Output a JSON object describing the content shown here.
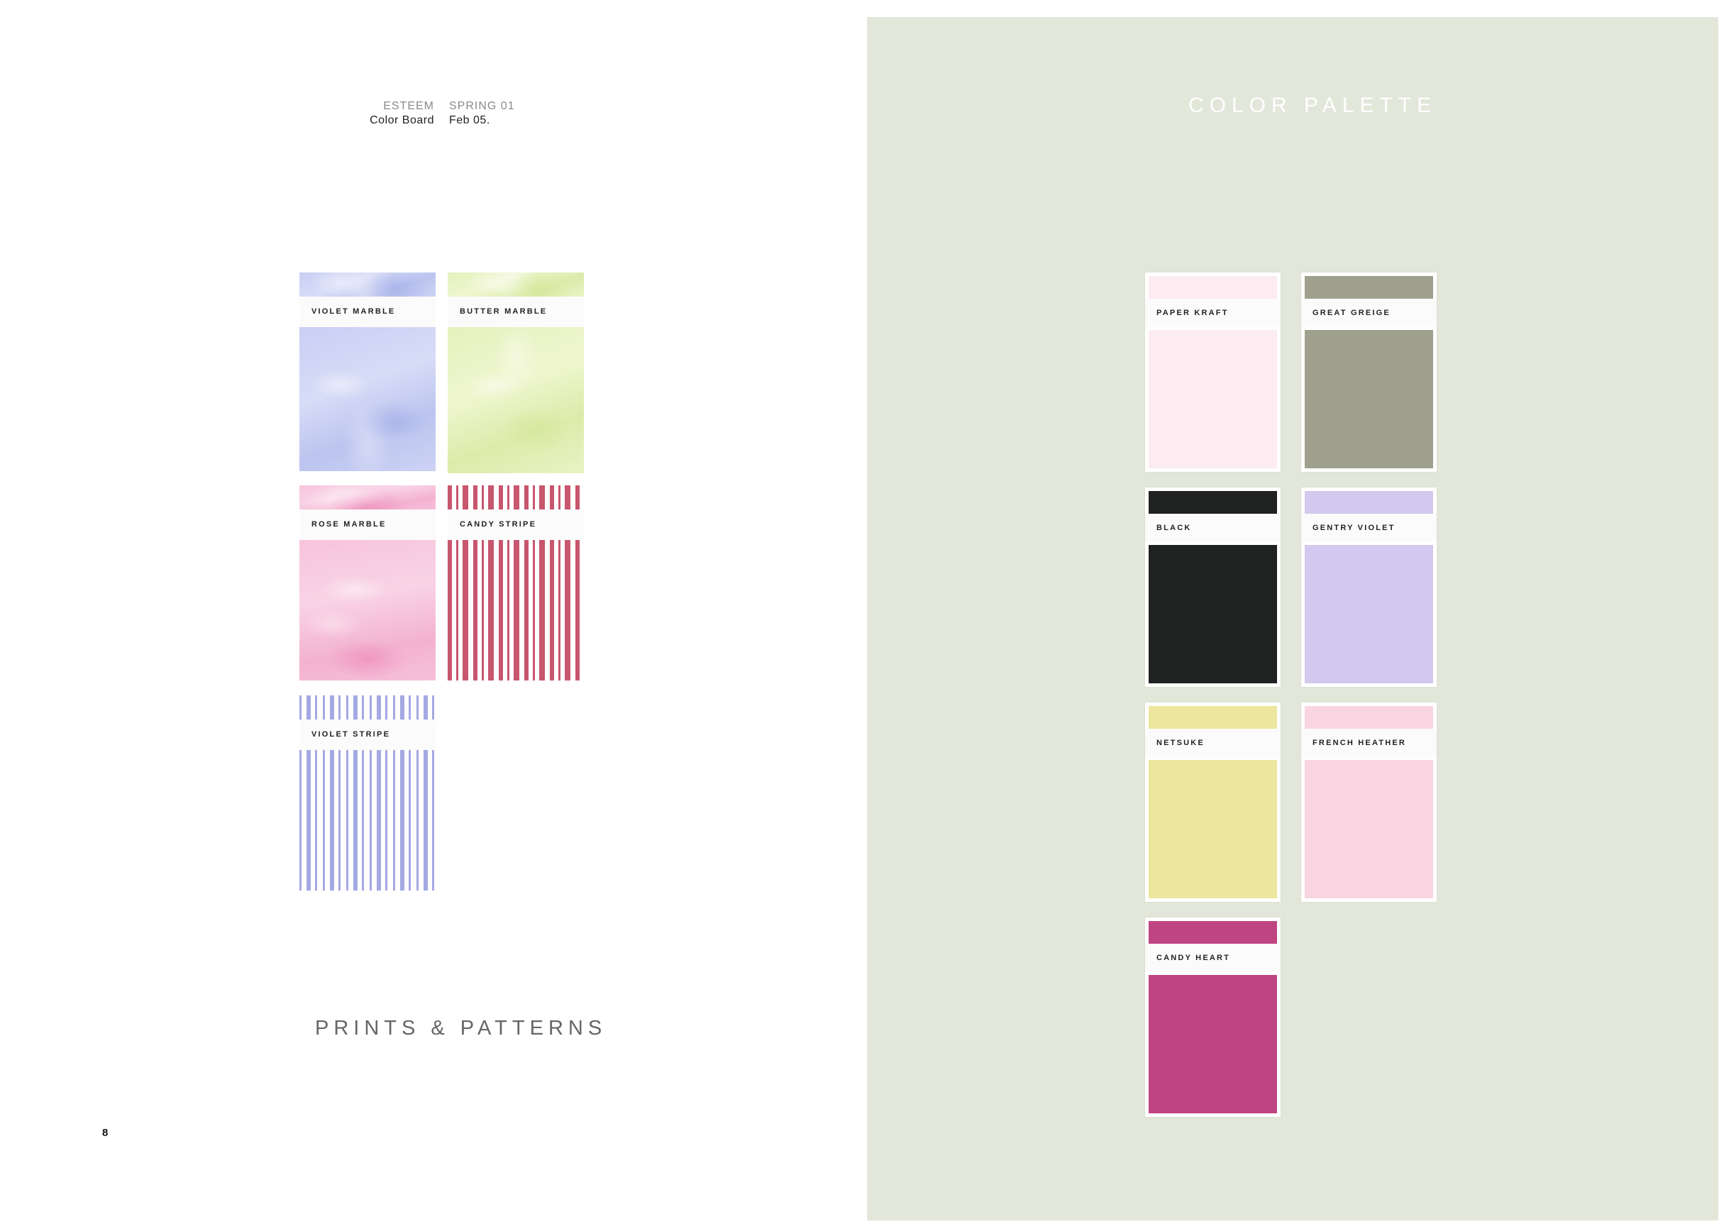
{
  "header": {
    "brand": "ESTEEM",
    "board": "Color Board",
    "season": "SPRING 01",
    "date": "Feb 05."
  },
  "left_page": {
    "title": "PRINTS & PATTERNS",
    "page_number": "8",
    "patterns": [
      {
        "label": "VIOLET MARBLE",
        "style": "marble",
        "color": "#c9cff4"
      },
      {
        "label": "BUTTER MARBLE",
        "style": "marble",
        "color": "#e5f1bd"
      },
      {
        "label": "ROSE MARBLE",
        "style": "marble",
        "color": "#f7c4dc"
      },
      {
        "label": "CANDY STRIPE",
        "style": "stripe",
        "color": "#c8566e"
      },
      {
        "label": "VIOLET STRIPE",
        "style": "stripe",
        "color": "#a3a9e3"
      }
    ]
  },
  "right_page": {
    "title": "COLOR PALETTE",
    "background": "#e2e7da",
    "swatches": [
      {
        "label": "PAPER KRAFT",
        "color": "#fcecf2"
      },
      {
        "label": "GREAT GREIGE",
        "color": "#a0a08f"
      },
      {
        "label": "BLACK",
        "color": "#1f2221"
      },
      {
        "label": "GENTRY VIOLET",
        "color": "#d3c8ed"
      },
      {
        "label": "NETSUKE",
        "color": "#ece69e"
      },
      {
        "label": "FRENCH HEATHER",
        "color": "#f8d5e1"
      },
      {
        "label": "CANDY HEART",
        "color": "#bf4582"
      }
    ]
  }
}
